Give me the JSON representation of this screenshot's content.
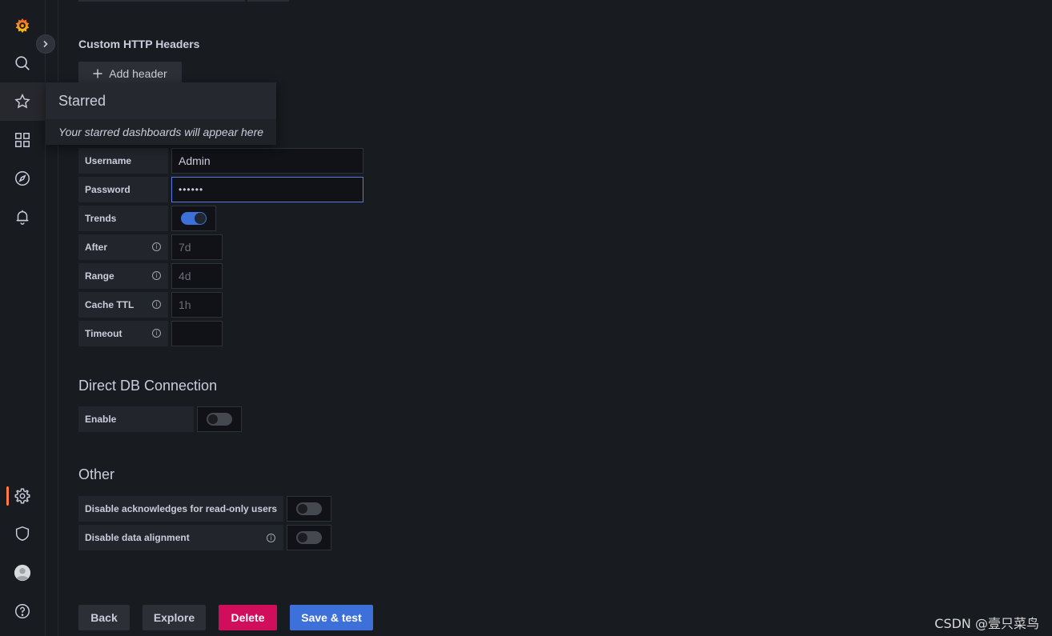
{
  "sidebar": {
    "expand_label": "›"
  },
  "popover": {
    "title": "Starred",
    "message": "Your starred dashboards will appear here"
  },
  "headers_section": {
    "title": "Custom HTTP Headers",
    "add_button": "Add header"
  },
  "auth": {
    "username_label": "Username",
    "username_value": "Admin",
    "password_label": "Password",
    "password_value": "••••••",
    "trends_label": "Trends",
    "trends_on": true,
    "after_label": "After",
    "after_placeholder": "7d",
    "range_label": "Range",
    "range_placeholder": "4d",
    "cache_ttl_label": "Cache TTL",
    "cache_ttl_placeholder": "1h",
    "timeout_label": "Timeout",
    "timeout_value": ""
  },
  "direct_db": {
    "title": "Direct DB Connection",
    "enable_label": "Enable",
    "enable_on": false
  },
  "other": {
    "title": "Other",
    "disable_ack_label": "Disable acknowledges for read-only users",
    "disable_ack_on": false,
    "disable_alignment_label": "Disable data alignment",
    "disable_alignment_on": false
  },
  "actions": {
    "back": "Back",
    "explore": "Explore",
    "delete": "Delete",
    "save_test": "Save & test"
  },
  "colors": {
    "accent_blue": "#3d71d9",
    "delete_pink": "#d10e5c",
    "active_orange": "#ff7c47"
  },
  "watermark": "CSDN @壹只菜鸟"
}
